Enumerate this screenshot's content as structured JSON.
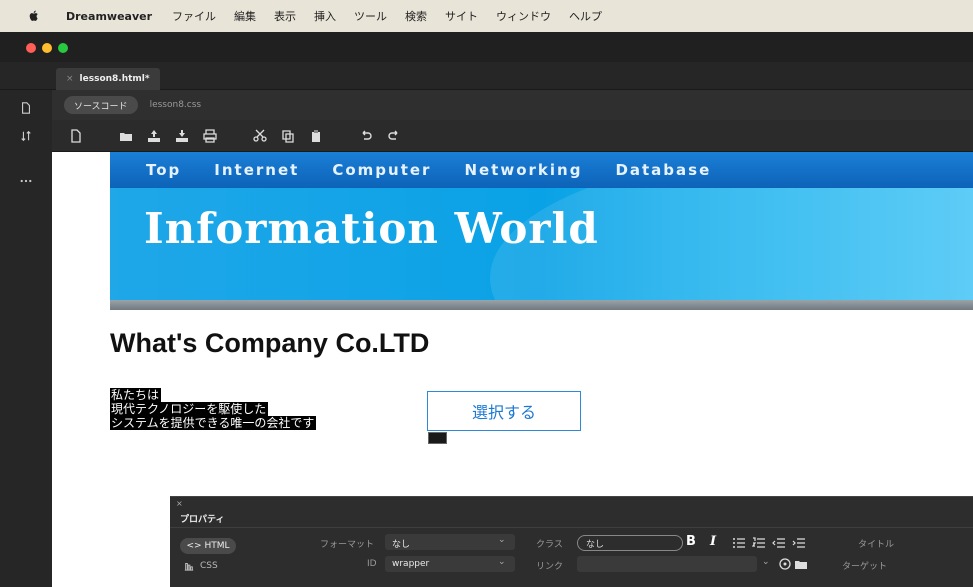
{
  "menubar": {
    "app": "Dreamweaver",
    "items": [
      "ファイル",
      "編集",
      "表示",
      "挿入",
      "ツール",
      "検索",
      "サイト",
      "ウィンドウ",
      "ヘルプ"
    ]
  },
  "tab": {
    "filename": "lesson8.html*",
    "close": "×"
  },
  "files": {
    "source": "ソースコード",
    "css": "lesson8.css"
  },
  "site": {
    "nav": [
      "Top",
      "Internet",
      "Computer",
      "Networking",
      "Database"
    ],
    "banner_title": "Information World",
    "company": "What's Company Co.LTD",
    "selected_lines": [
      "私たちは",
      "現代テクノロジーを駆使した",
      "システムを提供できる唯一の会社です"
    ]
  },
  "select_button": {
    "label": "選択する"
  },
  "properties": {
    "title": "プロパティ",
    "close": "×",
    "html": "<> HTML",
    "css": "CSS",
    "format_label": "フォーマット",
    "format_value": "なし",
    "id_label": "ID",
    "id_value": "wrapper",
    "class_label": "クラス",
    "class_value": "なし",
    "link_label": "リンク",
    "bold": "B",
    "italic": "I",
    "title_label": "タイトル",
    "target_label": "ターゲット"
  },
  "left_icons": [
    "file-icon",
    "sort-icon",
    "more-icon"
  ]
}
